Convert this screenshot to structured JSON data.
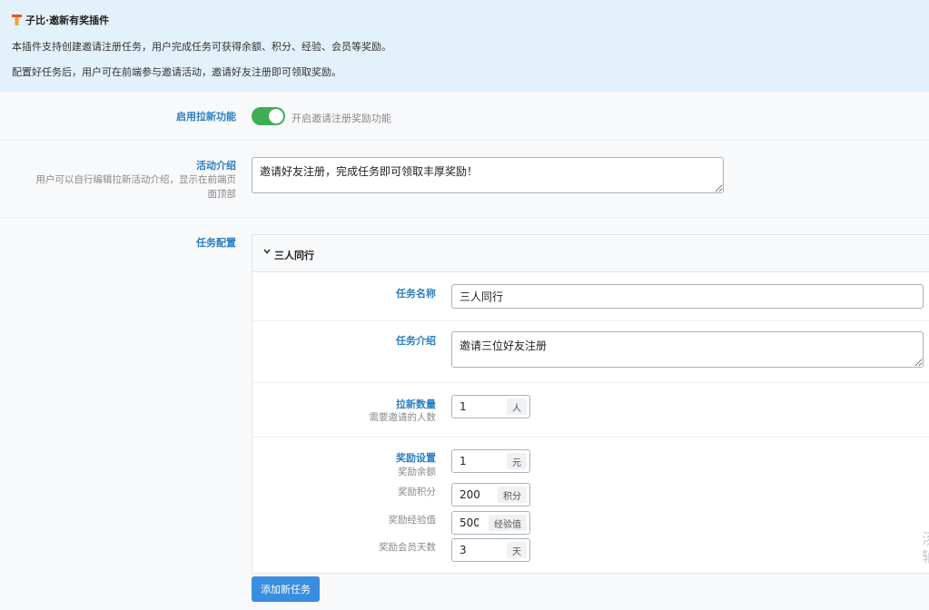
{
  "banner": {
    "title": "子比·邀新有奖插件",
    "line1": "本插件支持创建邀请注册任务，用户完成任务可获得余额、积分、经验、会员等奖励。",
    "line2": "配置好任务后，用户可在前端参与邀请活动，邀请好友注册即可领取奖励。"
  },
  "enable": {
    "label": "启用拉新功能",
    "toggle_on": true,
    "toggle_text": "开启邀请注册奖励功能"
  },
  "intro": {
    "label": "活动介绍",
    "help_line1": "用户可以自行编辑拉新活动介绍，显示在前端页",
    "help_line2": "面顶部",
    "value": "邀请好友注册，完成任务即可领取丰厚奖励！"
  },
  "tasks": {
    "label": "任务配置",
    "items": [
      {
        "header": "三人同行",
        "name_label": "任务名称",
        "name_value": "三人同行",
        "desc_label": "任务介绍",
        "desc_value": "邀请三位好友注册",
        "count_label": "拉新数量",
        "count_help": "需要邀请的人数",
        "count_value": "1",
        "count_unit": "人",
        "reward_label": "奖励设置",
        "rewards": [
          {
            "label": "奖励余额",
            "value": "1",
            "unit": "元"
          },
          {
            "label": "奖励积分",
            "value": "200",
            "unit": "积分"
          },
          {
            "label": "奖励经验值",
            "value": "500",
            "unit": "经验值"
          },
          {
            "label": "奖励会员天数",
            "value": "3",
            "unit": "天"
          }
        ]
      }
    ],
    "add_button": "添加新任务"
  },
  "overflow_chars": {
    "line1": "汤",
    "line2": "轴"
  },
  "colors": {
    "accent": "#2b7fc1",
    "toggle": "#3fae52",
    "button": "#3a8ee0",
    "banner_bg": "#e3f1fa"
  },
  "icons": {
    "logo": "plugin-logo-icon",
    "collapse": "chevron-down-icon"
  }
}
